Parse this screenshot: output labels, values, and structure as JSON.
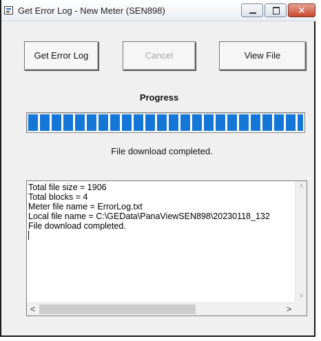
{
  "window": {
    "title": "Get Error Log - New Meter (SEN898)",
    "controls": {
      "minimize": "minimize-icon",
      "maximize": "maximize-icon",
      "close": "close-icon",
      "close_glyph": "✕"
    }
  },
  "buttons": {
    "get_error_log": "Get Error Log",
    "cancel": "Cancel",
    "view_file": "View File"
  },
  "progress": {
    "label": "Progress",
    "value": 1.0,
    "color": "#1476d6"
  },
  "status": "File download completed.",
  "log": {
    "lines": [
      "Total file size = 1906",
      "Total blocks = 4",
      "Meter file name = ErrorLog.txt",
      "Local file name = C:\\GEData\\PanaViewSEN898\\20230118_132",
      "File download completed."
    ]
  },
  "scroll": {
    "up_glyph": "˄",
    "down_glyph": "˅",
    "left_glyph": "<",
    "right_glyph": ">"
  }
}
